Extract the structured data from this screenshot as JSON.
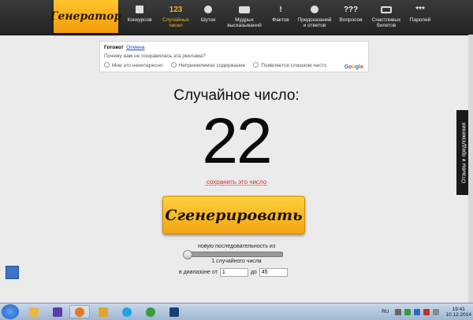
{
  "header": {
    "logo": "Генератор",
    "nav": [
      {
        "label": "Конкурсов",
        "icon": "gift-icon",
        "active": false
      },
      {
        "label": "Случайных\nчисел",
        "icon": "123-icon",
        "glyph": "123",
        "active": true
      },
      {
        "label": "Шуток",
        "icon": "smile-icon",
        "active": false
      },
      {
        "label": "Мудрых\nвысказываний",
        "icon": "scroll-icon",
        "active": false
      },
      {
        "label": "Фактов",
        "icon": "exclamation-icon",
        "glyph": "!",
        "active": false
      },
      {
        "label": "Предсказаний\nи ответов",
        "icon": "ball-icon",
        "active": false
      },
      {
        "label": "Вопросов",
        "icon": "question-icon",
        "glyph": "???",
        "active": false
      },
      {
        "label": "Счастливых\nбилетов",
        "icon": "ticket-icon",
        "active": false
      },
      {
        "label": "Паролей",
        "icon": "password-icon",
        "glyph": "***",
        "active": false
      }
    ]
  },
  "ad": {
    "done": "Готово!",
    "cancel": "Отмена",
    "question": "Почему вам не понравилась эта реклама?",
    "options": [
      "Мне это неинтересно",
      "Неприемлемое содержание",
      "Появляется слишком часто"
    ],
    "google": "Google"
  },
  "main": {
    "heading": "Случайное число:",
    "number": "22",
    "save_link": "сохранить это число",
    "generate_button": "Сгенерировать",
    "sequence_label": "новую последовательность из",
    "slider_fraction": 0,
    "count_label": "1 случайного числа",
    "range_label": "в диапазоне от",
    "range_from": "1",
    "range_to_label": "до",
    "range_to": "45"
  },
  "feedback_tab": "Отзывы и предложения",
  "taskbar": {
    "lang": "RU",
    "time": "19:41",
    "date": "10.12.2014"
  },
  "colors": {
    "accent": "#f6b21a",
    "link_red": "#c8342a",
    "button": "#f3a511"
  }
}
